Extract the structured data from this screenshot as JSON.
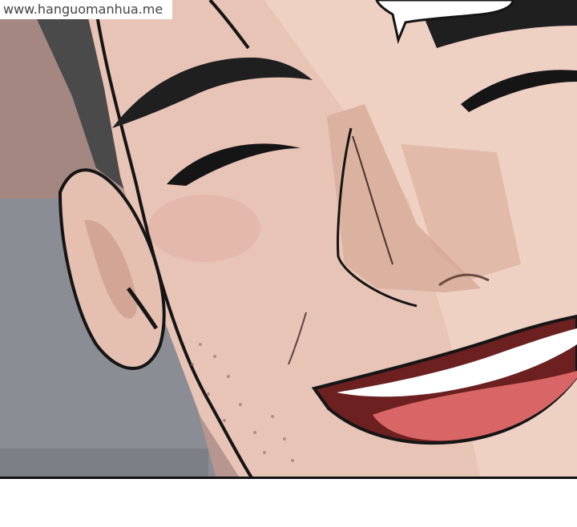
{
  "watermark": {
    "text": "www.hanguomanhua.me"
  },
  "colors": {
    "skin": "#e8c4b6",
    "skin_shadow": "#d3aa9a",
    "wall": "#b48f89",
    "carpet": "#8a8d93",
    "hair": "#3a3a3a",
    "mouth": "#6c2020",
    "tongue": "#d96666",
    "teeth": "#ffffff",
    "outline": "#151515"
  }
}
